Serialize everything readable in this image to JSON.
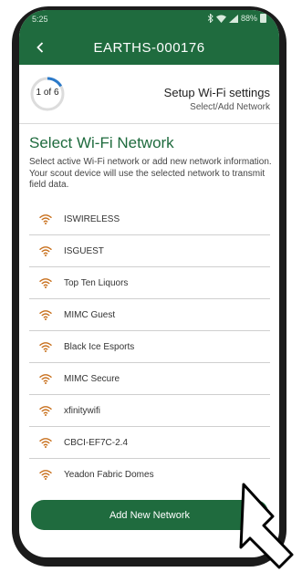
{
  "status_bar": {
    "time": "5:25",
    "battery": "88%"
  },
  "app_bar": {
    "title": "EARTHS-000176",
    "back_icon": "chevron-left-icon"
  },
  "step": {
    "label": "1 of 6",
    "current": 1,
    "total": 6,
    "title": "Setup Wi-Fi settings",
    "subtitle": "Select/Add Network"
  },
  "section": {
    "title": "Select Wi-Fi Network",
    "description": "Select active Wi-Fi network or add new network information. Your scout device will use the selected network to transmit field data."
  },
  "networks": [
    {
      "name": "ISWIRELESS"
    },
    {
      "name": "ISGUEST"
    },
    {
      "name": "Top Ten Liquors"
    },
    {
      "name": "MIMC Guest"
    },
    {
      "name": "Black Ice Esports"
    },
    {
      "name": "MIMC Secure"
    },
    {
      "name": "xfinitywifi"
    },
    {
      "name": "CBCI-EF7C-2.4"
    },
    {
      "name": "Yeadon Fabric Domes"
    }
  ],
  "add_button": {
    "label": "Add New Network"
  },
  "colors": {
    "primary": "#1f6b3e",
    "wifi_icon": "#c8701d",
    "progress": "#2a79c9"
  },
  "icons": {
    "network_icon": "wifi-icon",
    "cursor": "pointer-arrow-icon"
  }
}
